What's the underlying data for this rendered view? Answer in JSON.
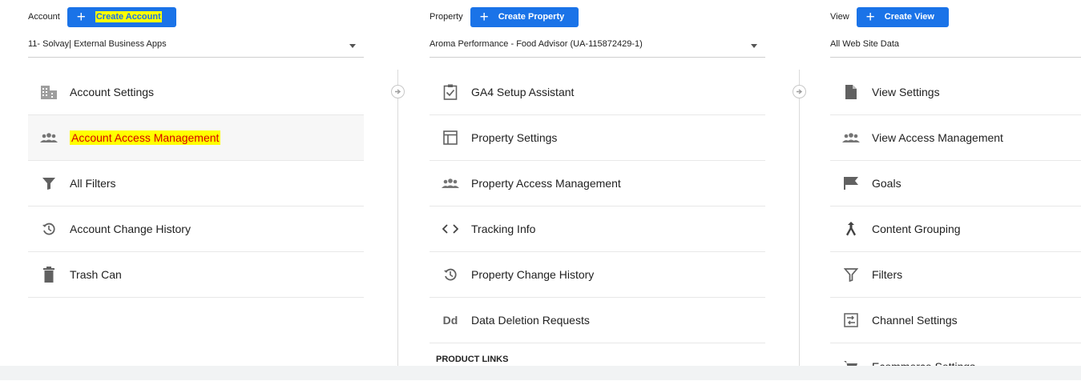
{
  "account": {
    "label": "Account",
    "create_label": "Create Account",
    "selected": "11- Solvay| External Business Apps",
    "items": [
      {
        "label": "Account Settings"
      },
      {
        "label": "Account Access Management"
      },
      {
        "label": "All Filters"
      },
      {
        "label": "Account Change History"
      },
      {
        "label": "Trash Can"
      }
    ]
  },
  "property": {
    "label": "Property",
    "create_label": "Create Property",
    "selected": "Aroma Performance - Food Advisor (UA-115872429-1)",
    "items": [
      {
        "label": "GA4 Setup Assistant"
      },
      {
        "label": "Property Settings"
      },
      {
        "label": "Property Access Management"
      },
      {
        "label": "Tracking Info"
      },
      {
        "label": "Property Change History"
      },
      {
        "label": "Data Deletion Requests",
        "icon_text": "Dd"
      }
    ],
    "section_header": "PRODUCT LINKS"
  },
  "view": {
    "label": "View",
    "create_label": "Create View",
    "selected": "All Web Site Data",
    "items": [
      {
        "label": "View Settings"
      },
      {
        "label": "View Access Management"
      },
      {
        "label": "Goals"
      },
      {
        "label": "Content Grouping"
      },
      {
        "label": "Filters"
      },
      {
        "label": "Channel Settings"
      },
      {
        "label": "Ecommerce Settings"
      }
    ]
  },
  "colors": {
    "primary": "#1a73e8",
    "highlight": "#ffff00",
    "highlight_text": "#d50000",
    "icon": "#616161"
  }
}
